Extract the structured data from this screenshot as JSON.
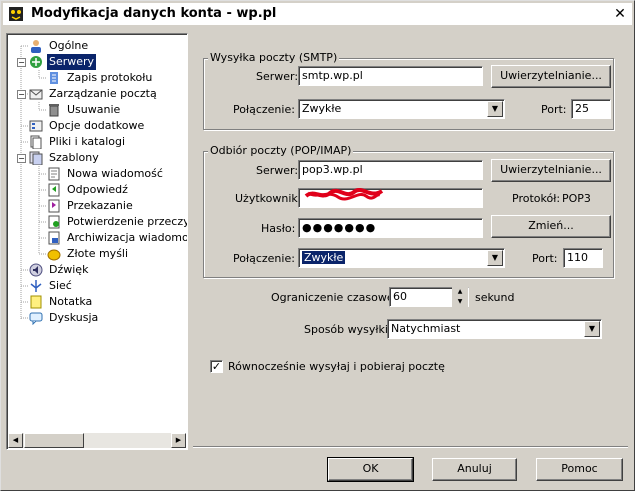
{
  "window": {
    "title": "Modyfikacja danych konta - wp.pl",
    "close_glyph": "✕"
  },
  "tree": {
    "items": [
      {
        "label": "Ogólne",
        "icon": "person-icon"
      },
      {
        "label": "Serwery",
        "icon": "servers-icon",
        "selected": true
      },
      {
        "label": "Zapis protokołu",
        "icon": "log-icon"
      },
      {
        "label": "Zarządzanie pocztą",
        "icon": "mail-manage-icon"
      },
      {
        "label": "Usuwanie",
        "icon": "trash-icon"
      },
      {
        "label": "Opcje dodatkowe",
        "icon": "options-icon"
      },
      {
        "label": "Pliki i katalogi",
        "icon": "files-icon"
      },
      {
        "label": "Szablony",
        "icon": "templates-icon"
      },
      {
        "label": "Nowa wiadomość",
        "icon": "new-message-icon"
      },
      {
        "label": "Odpowiedź",
        "icon": "reply-icon"
      },
      {
        "label": "Przekazanie",
        "icon": "forward-icon"
      },
      {
        "label": "Potwierdzenie przeczyta",
        "icon": "confirm-icon"
      },
      {
        "label": "Archiwizacja wiadomośc",
        "icon": "archive-icon"
      },
      {
        "label": "Złote myśli",
        "icon": "golden-thoughts-icon"
      },
      {
        "label": "Dźwięk",
        "icon": "sound-icon"
      },
      {
        "label": "Sieć",
        "icon": "network-icon"
      },
      {
        "label": "Notatka",
        "icon": "note-icon"
      },
      {
        "label": "Dyskusja",
        "icon": "discussion-icon"
      }
    ]
  },
  "smtp": {
    "group_title": "Wysyłka poczty (SMTP)",
    "server_label": "Serwer:",
    "server_value": "smtp.wp.pl",
    "auth_button": "Uwierzytelnianie...",
    "connection_label": "Połączenie:",
    "connection_value": "Zwykłe",
    "port_label": "Port:",
    "port_value": "25"
  },
  "pop": {
    "group_title": "Odbiór poczty (POP/IMAP)",
    "server_label": "Serwer:",
    "server_value": "pop3.wp.pl",
    "auth_button": "Uwierzytelnianie...",
    "user_label": "Użytkownik:",
    "protocol_label": "Protokół:",
    "protocol_value": "POP3",
    "password_label": "Hasło:",
    "password_value": "●●●●●●●",
    "change_button": "Zmień...",
    "connection_label": "Połączenie:",
    "connection_value": "Zwykłe",
    "port_label": "Port:",
    "port_value": "110"
  },
  "options": {
    "timeout_label": "Ograniczenie czasowe:",
    "timeout_value": "60",
    "timeout_unit": "sekund",
    "send_mode_label": "Sposób wysyłki:",
    "send_mode_value": "Natychmiast",
    "simultaneous_label": "Równocześnie wysyłaj i pobieraj pocztę",
    "simultaneous_checked": "✓"
  },
  "buttons": {
    "ok": "OK",
    "cancel": "Anuluj",
    "help": "Pomoc"
  },
  "colors": {
    "selection": "#0a246a",
    "redaction": "#e0001a"
  }
}
